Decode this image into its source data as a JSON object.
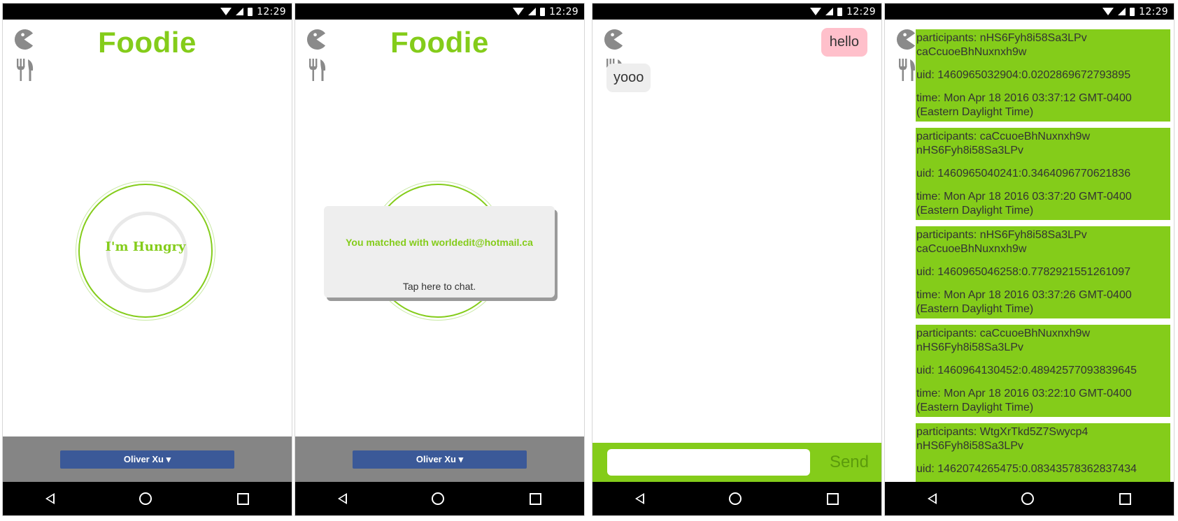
{
  "status": {
    "time": "12:29"
  },
  "app": {
    "logo_text": "Foodie"
  },
  "home": {
    "hungry_label": "I'm Hungry",
    "fb_button_label": "Oliver Xu ▾"
  },
  "match": {
    "title": "You matched with worldedit@hotmail.ca",
    "subtitle": "Tap here to chat."
  },
  "chat": {
    "messages": [
      {
        "text": "hello",
        "direction": "outgoing"
      },
      {
        "text": "yooo",
        "direction": "incoming"
      }
    ],
    "input_value": "",
    "send_label": "Send"
  },
  "conversations": [
    {
      "participants": "participants: nHS6Fyh8i58Sa3LPv caCcuoeBhNuxnxh9w",
      "uid": "uid: 1460965032904:0.0202869672793895",
      "time": "time: Mon Apr 18 2016 03:37:12 GMT-0400 (Eastern Daylight Time)"
    },
    {
      "participants": "participants: caCcuoeBhNuxnxh9w nHS6Fyh8i58Sa3LPv",
      "uid": "uid: 1460965040241:0.3464096770621836",
      "time": "time: Mon Apr 18 2016 03:37:20 GMT-0400 (Eastern Daylight Time)"
    },
    {
      "participants": "participants: nHS6Fyh8i58Sa3LPv caCcuoeBhNuxnxh9w",
      "uid": "uid: 1460965046258:0.7782921551261097",
      "time": "time: Mon Apr 18 2016 03:37:26 GMT-0400 (Eastern Daylight Time)"
    },
    {
      "participants": "participants: caCcuoeBhNuxnxh9w nHS6Fyh8i58Sa3LPv",
      "uid": "uid: 1460964130452:0.48942577093839645",
      "time": "time: Mon Apr 18 2016 03:22:10 GMT-0400 (Eastern Daylight Time)"
    },
    {
      "participants": "participants: WtgXrTkd5Z7Swycp4 nHS6Fyh8i58Sa3LPv",
      "uid": "uid: 1462074265475:0.08343578362837434",
      "time": ""
    }
  ],
  "colors": {
    "brand_green": "#84cc1a",
    "facebook_blue": "#3b5998",
    "footer_gray": "#858585",
    "outgoing_bubble": "#ffc0cb",
    "incoming_bubble": "#eeeeee"
  },
  "icons": [
    "pacman-icon",
    "fork-knife-icon",
    "wifi-icon",
    "signal-icon",
    "battery-icon",
    "back-icon",
    "home-icon",
    "recent-apps-icon"
  ]
}
